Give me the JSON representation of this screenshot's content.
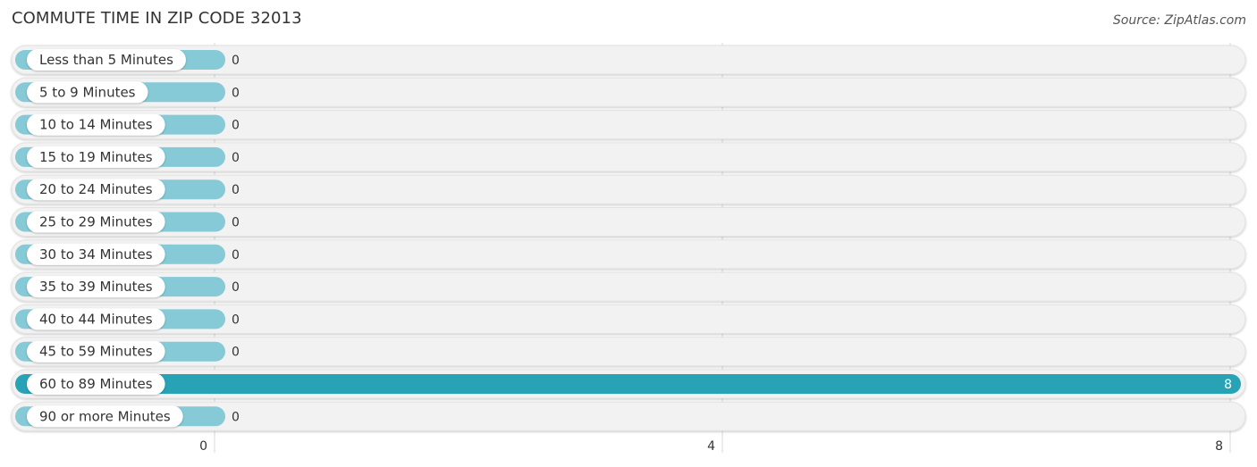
{
  "chart_data": {
    "type": "bar",
    "orientation": "horizontal",
    "title": "COMMUTE TIME IN ZIP CODE 32013",
    "source": "Source: ZipAtlas.com",
    "categories": [
      "Less than 5 Minutes",
      "5 to 9 Minutes",
      "10 to 14 Minutes",
      "15 to 19 Minutes",
      "20 to 24 Minutes",
      "25 to 29 Minutes",
      "30 to 34 Minutes",
      "35 to 39 Minutes",
      "40 to 44 Minutes",
      "45 to 59 Minutes",
      "60 to 89 Minutes",
      "90 or more Minutes"
    ],
    "values": [
      0,
      0,
      0,
      0,
      0,
      0,
      0,
      0,
      0,
      0,
      8,
      0
    ],
    "xlim": [
      0,
      8
    ],
    "xticks": [
      0,
      4,
      8
    ],
    "xlabel": "",
    "ylabel": "",
    "grid": true,
    "colors": {
      "bar": "#85cad6",
      "bar_highlight": "#27a3b5",
      "track": "#f2f2f2",
      "grid": "#d8d8d8"
    }
  }
}
